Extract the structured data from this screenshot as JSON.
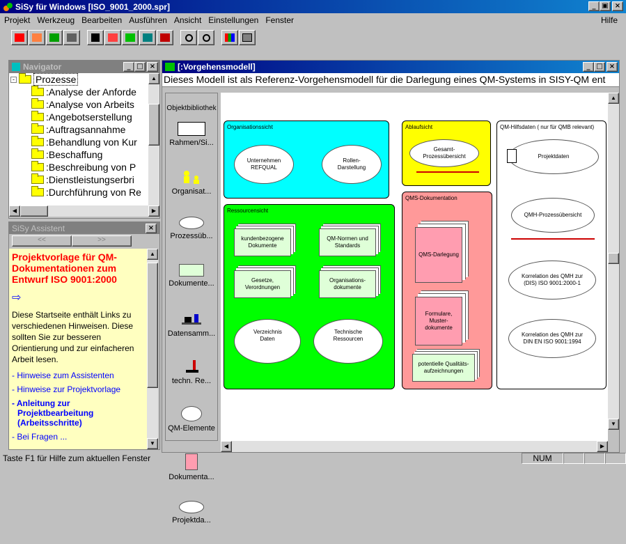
{
  "app": {
    "title": "SiSy für Windows [ISO_9001_2000.spr]"
  },
  "menu": {
    "items": [
      "Projekt",
      "Werkzeug",
      "Bearbeiten",
      "Ausführen",
      "Ansicht",
      "Einstellungen",
      "Fenster"
    ],
    "help": "Hilfe"
  },
  "toolbar": {
    "icons": [
      "open-folder-icon",
      "save-icon",
      "new-icon",
      "print-icon",
      "binoculars-icon",
      "tool-icon",
      "diagram-a-icon",
      "diagram-b-icon",
      "diagram-c-icon",
      "zoom-in-icon",
      "zoom-out-icon",
      "chart-icon",
      "dialog-icon"
    ]
  },
  "navigator": {
    "title": "Navigator",
    "root": "Prozesse",
    "items": [
      ":Analyse der Anforde",
      ":Analyse von Arbeits",
      ":Angebotserstellung",
      ":Auftragsannahme",
      ":Behandlung von Kur",
      ":Beschaffung",
      ":Beschreibung von P",
      ":Dienstleistungserbri",
      ":Durchführung von Re"
    ]
  },
  "assistant": {
    "title": "SiSy Assistent",
    "nav_prev": "<<",
    "nav_next": ">>",
    "heading": "Projektvorlage für QM-Dokumentationen zum Entwurf ISO 9001:2000",
    "arrow": "⇨",
    "body": "Diese Startseite enthält Links zu verschiedenen Hinweisen. Diese sollten Sie zur besseren Orientierung und zur einfacheren Arbeit lesen.",
    "links": [
      "- Hinweise zum Assistenten",
      "- Hinweise zur Projektvorlage"
    ],
    "bold_link": [
      "- Anleitung zur",
      "Projektbearbeitung",
      "(Arbeitsschritte)"
    ],
    "last_link": "- Bei Fragen ..."
  },
  "model_window": {
    "title": "[:Vorgehensmodell]",
    "description": "Dieses Modell ist als Referenz-Vorgehensmodell für die Darlegung eines QM-Systems in SISY-QM ent",
    "library_title": "Objektbibliothek",
    "library": [
      {
        "label": "Rahmen/Si...",
        "icon": "frame-icon"
      },
      {
        "label": "Organisat...",
        "icon": "people-icon"
      },
      {
        "label": "Prozessüb...",
        "icon": "process-cloud-icon"
      },
      {
        "label": "Dokumente...",
        "icon": "documents-icon"
      },
      {
        "label": "Datensamm...",
        "icon": "data-collection-icon"
      },
      {
        "label": "techn. Re...",
        "icon": "microscope-icon"
      },
      {
        "label": "QM-Elemente",
        "icon": "qm-element-icon"
      },
      {
        "label": "Dokumenta...",
        "icon": "documentation-icon"
      },
      {
        "label": "Projektda...",
        "icon": "project-data-icon"
      }
    ],
    "sections": {
      "org": {
        "title": "Organisationssicht",
        "items": [
          "Unternehmen REFQUAL",
          "Rollen-Darstellung"
        ]
      },
      "ablauf": {
        "title": "Ablaufsicht",
        "items": [
          "Gesamt-Prozessübersicht"
        ]
      },
      "hilfs": {
        "title": "QM-Hilfsdaten ( nur für QMB relevant)",
        "items": [
          "Projektdaten",
          "QMH-Prozessübersicht",
          "Korrelation des QMH zur (DIS) ISO 9001:2000-1",
          "Korrelation des QMH zur DIN EN ISO 9001:1994"
        ]
      },
      "ress": {
        "title": "Ressourcensicht",
        "items": [
          "kundenbezogene Dokumente",
          "QM-Normen und Standards",
          "Gesetze, Verordnungen",
          "Organisations-dokumente",
          "Verzeichnis Daten",
          "Technische Ressourcen"
        ]
      },
      "qms": {
        "title": "QMS-Dokumentation",
        "items": [
          "QMS-Darlegung",
          "Formulare, Muster-dokumente",
          "potentielle Qualitäts-aufzeichnungen"
        ]
      }
    }
  },
  "statusbar": {
    "text": "Taste F1 für Hilfe zum aktuellen Fenster",
    "num": "NUM"
  },
  "colors": {
    "title_active": "#000080",
    "org": "#00ffff",
    "ablauf": "#ffff00",
    "ress": "#00ff00",
    "qms": "#ff9999",
    "assistant_bg": "#ffffc0"
  }
}
